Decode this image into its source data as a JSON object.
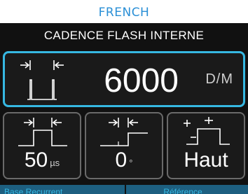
{
  "language_label": "FRENCH",
  "screen": {
    "title": "CADENCE FLASH INTERNE",
    "rate": {
      "value": "6000",
      "unit": "D/M",
      "icon": "flash-rate-icon"
    },
    "tiles": {
      "pulse_width": {
        "value": "50",
        "unit": "µs",
        "icon": "pulse-width-icon"
      },
      "delay": {
        "value": "0",
        "unit": "°",
        "icon": "delay-icon"
      },
      "edge": {
        "value": "Haut",
        "icon": "edge-high-icon"
      }
    },
    "bottom_bar": {
      "left_label": "Base Recurrent",
      "right_label": "Référence"
    }
  },
  "colors": {
    "accent": "#36b8e2",
    "language_label": "#2a8fd6",
    "screen_background": "#111111",
    "tile_border": "#6a6a6a",
    "bottom_bar": "#1d5f80"
  }
}
